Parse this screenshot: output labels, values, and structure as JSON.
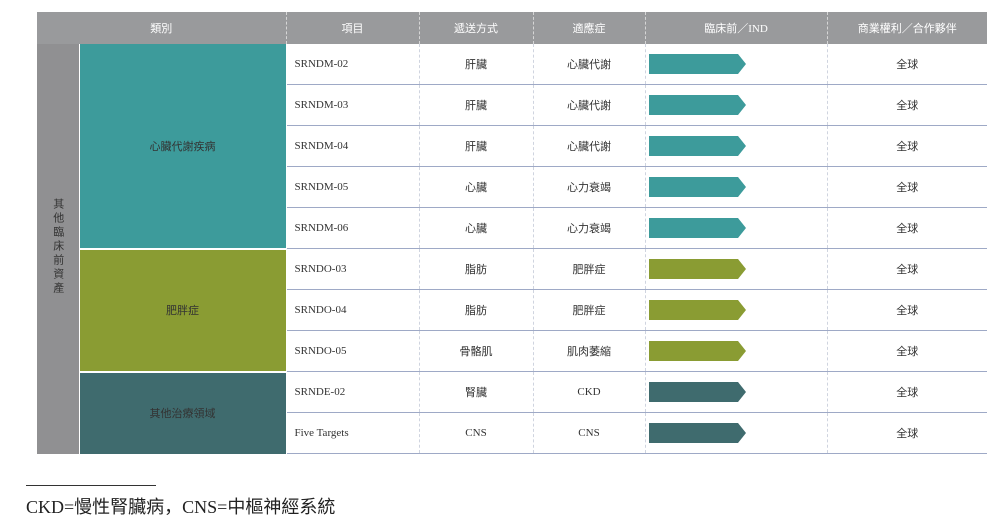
{
  "headers": [
    "類別",
    "項目",
    "遞送方式",
    "適應症",
    "臨床前／IND",
    "商業權利／合作夥伴"
  ],
  "group_label": "其他臨床前資產",
  "categories": [
    {
      "name": "心臟代謝疾病",
      "color": "#3d9b9b"
    },
    {
      "name": "肥胖症",
      "color": "#8a9c33"
    },
    {
      "name": "其他治療領域",
      "color": "#3f6b6e"
    }
  ],
  "rows": [
    {
      "project": "SRNDM-02",
      "delivery": "肝臟",
      "indication": "心臟代謝",
      "rights": "全球",
      "bar_color": "#3d9b9b"
    },
    {
      "project": "SRNDM-03",
      "delivery": "肝臟",
      "indication": "心臟代謝",
      "rights": "全球",
      "bar_color": "#3d9b9b"
    },
    {
      "project": "SRNDM-04",
      "delivery": "肝臟",
      "indication": "心臟代謝",
      "rights": "全球",
      "bar_color": "#3d9b9b"
    },
    {
      "project": "SRNDM-05",
      "delivery": "心臟",
      "indication": "心力衰竭",
      "rights": "全球",
      "bar_color": "#3d9b9b"
    },
    {
      "project": "SRNDM-06",
      "delivery": "心臟",
      "indication": "心力衰竭",
      "rights": "全球",
      "bar_color": "#3d9b9b"
    },
    {
      "project": "SRNDO-03",
      "delivery": "脂肪",
      "indication": "肥胖症",
      "rights": "全球",
      "bar_color": "#8a9c33"
    },
    {
      "project": "SRNDO-04",
      "delivery": "脂肪",
      "indication": "肥胖症",
      "rights": "全球",
      "bar_color": "#8a9c33"
    },
    {
      "project": "SRNDO-05",
      "delivery": "骨骼肌",
      "indication": "肌肉萎縮",
      "rights": "全球",
      "bar_color": "#8a9c33"
    },
    {
      "project": "SRNDE-02",
      "delivery": "腎臟",
      "indication": "CKD",
      "rights": "全球",
      "bar_color": "#3f6b6e"
    },
    {
      "project": "Five Targets",
      "delivery": "CNS",
      "indication": "CNS",
      "rights": "全球",
      "bar_color": "#3f6b6e"
    }
  ],
  "footnote": "CKD=慢性腎臟病，CNS=中樞神經系統"
}
